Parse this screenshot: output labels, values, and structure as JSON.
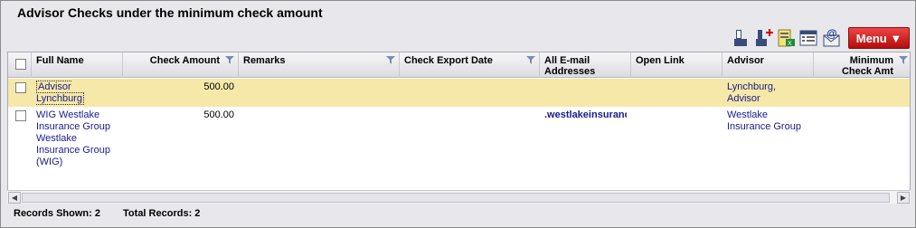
{
  "page": {
    "title": "Advisor Checks under the minimum check amount"
  },
  "toolbar": {
    "icons": [
      "pin-report-icon",
      "pin-add-icon",
      "export-excel-icon",
      "column-chooser-icon",
      "email-icon"
    ],
    "menu_label": "Menu ▼"
  },
  "grid": {
    "columns": [
      "Full Name",
      "Check Amount",
      "Remarks",
      "Check Export Date",
      "All E-mail Addresses",
      "Open Link",
      "Advisor",
      "Minimum Check Amt"
    ],
    "rows": [
      {
        "full_name": "Advisor Lynchburg",
        "check_amount": "500.00",
        "remarks": "",
        "check_export_date": "",
        "emails": "",
        "open_link": "",
        "advisor": "Lynchburg, Advisor",
        "minimum_check_amt": ""
      },
      {
        "full_name": "WIG Westlake Insurance Group Westlake Insurance Group (WIG)",
        "check_amount": "500.00",
        "remarks": "",
        "check_export_date": "",
        "emails": ".westlakeinsurance",
        "open_link": "",
        "advisor": "Westlake Insurance Group",
        "minimum_check_amt": ""
      }
    ]
  },
  "status": {
    "records_shown": "Records Shown: 2",
    "total_records": "Total Records: 2"
  },
  "colors": {
    "selected_row": "#f6e8a8",
    "menu_button": "#c91414",
    "link": "#1a1a8c"
  }
}
